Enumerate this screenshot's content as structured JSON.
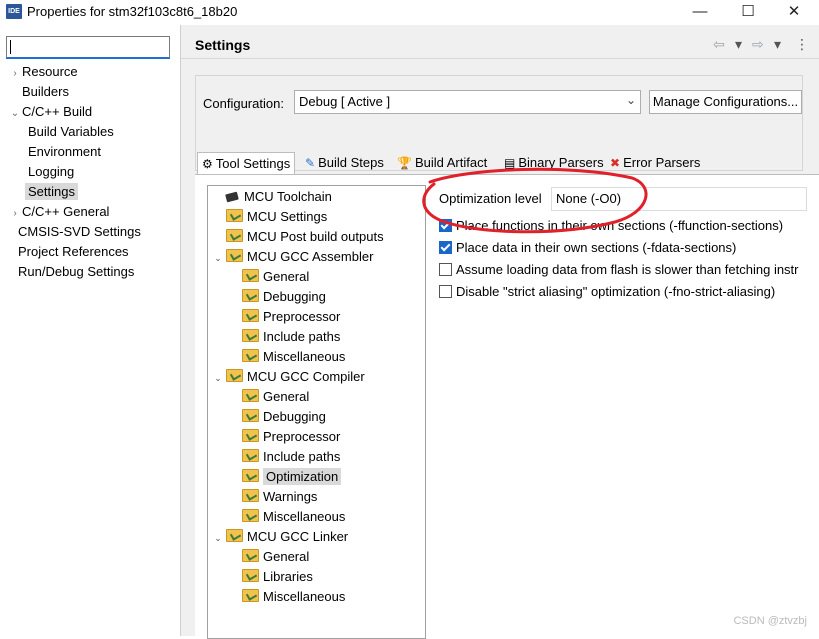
{
  "window": {
    "icon_text": "IDE",
    "title": "Properties for stm32f103c8t6_18b20",
    "minimize": "—",
    "maximize": "☐",
    "close": "✕"
  },
  "sidebar": {
    "filter_value": "",
    "items": [
      {
        "label": "Resource",
        "arrow": "›"
      },
      {
        "label": "Builders"
      },
      {
        "label": "C/C++ Build",
        "arrow": "⌄"
      },
      {
        "label": "Build Variables"
      },
      {
        "label": "Environment"
      },
      {
        "label": "Logging"
      },
      {
        "label": "Settings"
      },
      {
        "label": "C/C++ General",
        "arrow": "›"
      },
      {
        "label": "CMSIS-SVD Settings"
      },
      {
        "label": "Project References"
      },
      {
        "label": "Run/Debug Settings"
      }
    ]
  },
  "header": {
    "title": "Settings",
    "back": "⇦",
    "forward": "⇨",
    "dropdown": "▾",
    "menu": "⋮"
  },
  "config": {
    "label": "Configuration:",
    "value": "Debug  [ Active ]",
    "chevron": "⌄",
    "manage_button": "Manage Configurations..."
  },
  "tabs": [
    {
      "label": "Tool Settings",
      "icon": "⚙"
    },
    {
      "label": "Build Steps",
      "icon": "✎"
    },
    {
      "label": "Build Artifact",
      "icon": "🏆"
    },
    {
      "label": "Binary Parsers",
      "icon": "▤"
    },
    {
      "label": "Error Parsers",
      "icon": "✖"
    }
  ],
  "tree": {
    "toggle": "⌄",
    "items": [
      {
        "label": "MCU Toolchain"
      },
      {
        "label": "MCU Settings"
      },
      {
        "label": "MCU Post build outputs"
      },
      {
        "label": "MCU GCC Assembler"
      },
      {
        "label": "General"
      },
      {
        "label": "Debugging"
      },
      {
        "label": "Preprocessor"
      },
      {
        "label": "Include paths"
      },
      {
        "label": "Miscellaneous"
      },
      {
        "label": "MCU GCC Compiler"
      },
      {
        "label": "General"
      },
      {
        "label": "Debugging"
      },
      {
        "label": "Preprocessor"
      },
      {
        "label": "Include paths"
      },
      {
        "label": "Optimization"
      },
      {
        "label": "Warnings"
      },
      {
        "label": "Miscellaneous"
      },
      {
        "label": "MCU GCC Linker"
      },
      {
        "label": "General"
      },
      {
        "label": "Libraries"
      },
      {
        "label": "Miscellaneous"
      }
    ]
  },
  "options": {
    "optimization_label": "Optimization level",
    "optimization_value": "None (-O0)",
    "checkboxes": [
      {
        "label": "Place functions in their own sections (-ffunction-sections)",
        "checked": true
      },
      {
        "label": "Place data in their own sections (-fdata-sections)",
        "checked": true
      },
      {
        "label": "Assume loading data from flash is slower than fetching instr",
        "checked": false
      },
      {
        "label": "Disable \"strict aliasing\" optimization (-fno-strict-aliasing)",
        "checked": false
      }
    ]
  },
  "annotation_color": "#e0202a",
  "watermark": "CSDN @ztvzbj"
}
